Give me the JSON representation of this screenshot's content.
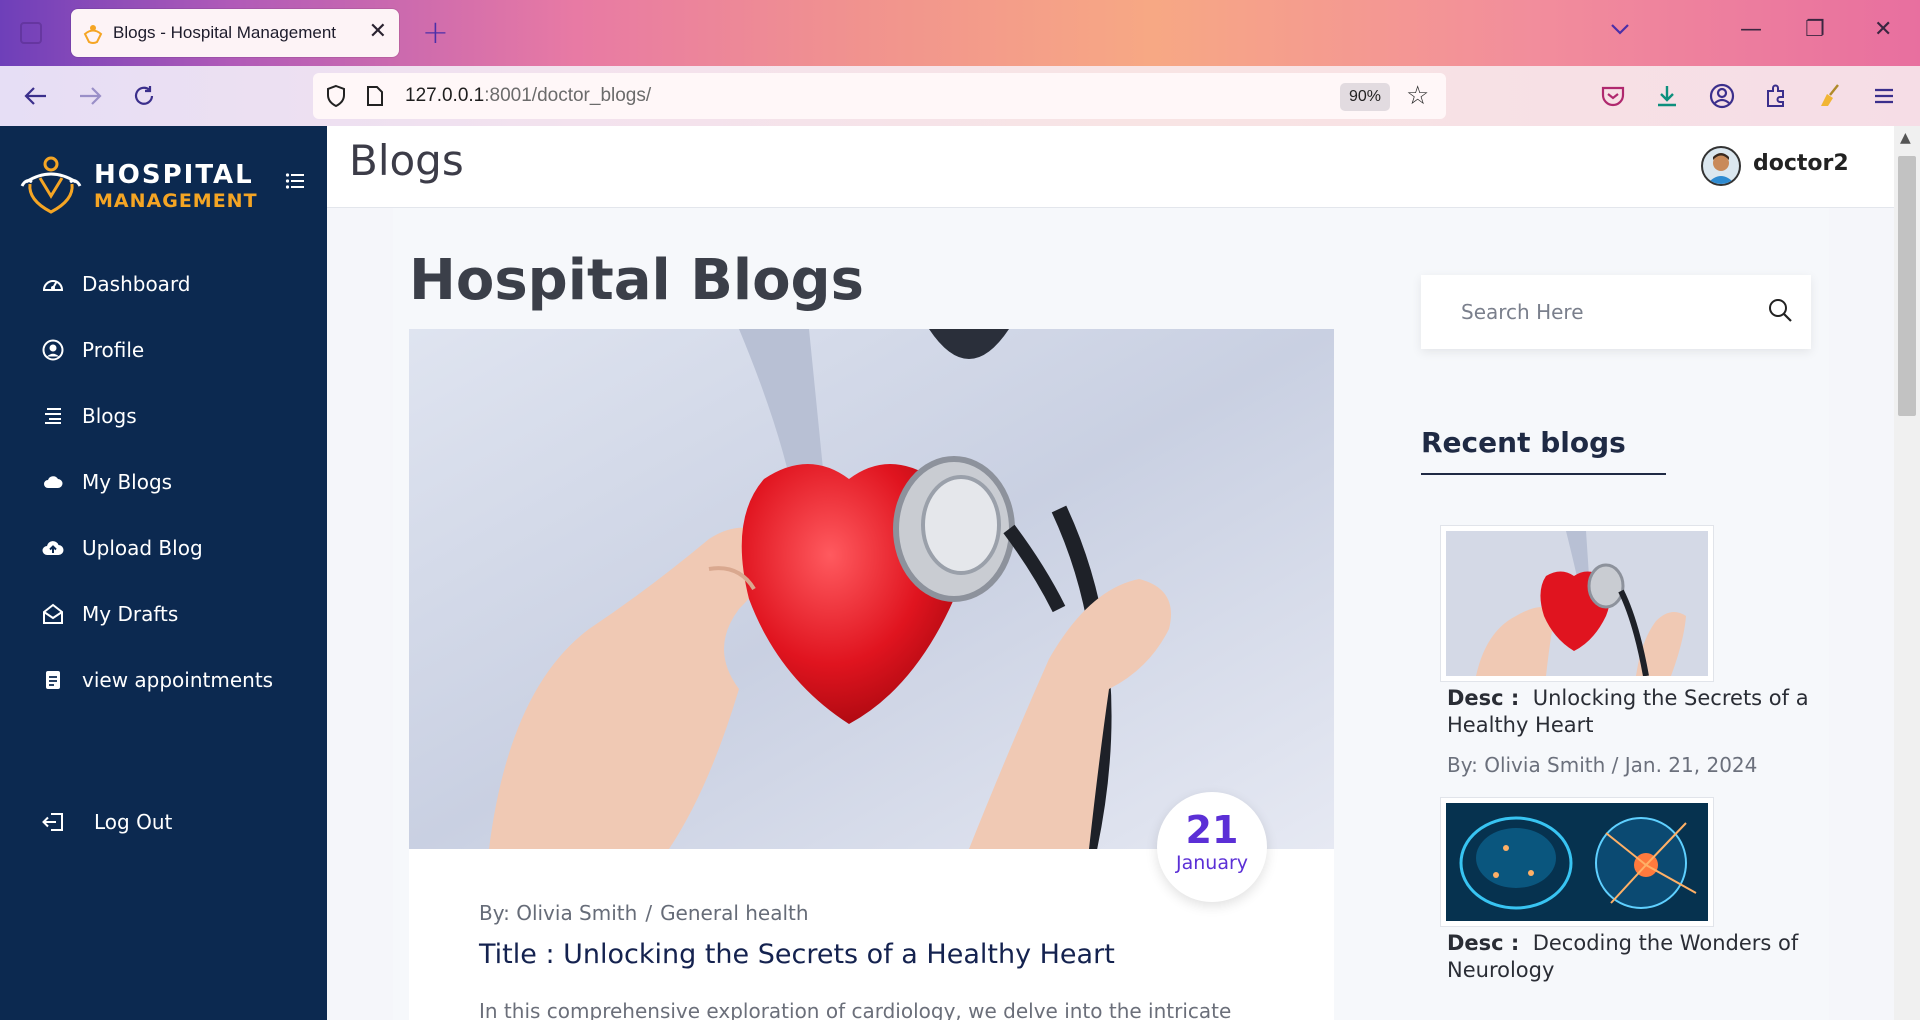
{
  "browser": {
    "tab_title": "Blogs - Hospital Management",
    "url_host": "127.0.0.1",
    "url_rest": ":8001/doctor_blogs/",
    "zoom": "90%"
  },
  "sidebar": {
    "brand_line1": "HOSPITAL",
    "brand_line2": "MANAGEMENT",
    "items": [
      {
        "label": "Dashboard",
        "icon": "dashboard-icon"
      },
      {
        "label": "Profile",
        "icon": "user-circle-icon"
      },
      {
        "label": "Blogs",
        "icon": "list-icon"
      },
      {
        "label": "My Blogs",
        "icon": "cloud-icon"
      },
      {
        "label": "Upload Blog",
        "icon": "cloud-upload-icon"
      },
      {
        "label": "My Drafts",
        "icon": "envelope-open-icon"
      },
      {
        "label": "view appointments",
        "icon": "document-icon"
      }
    ],
    "logout": {
      "label": "Log Out",
      "icon": "logout-icon"
    }
  },
  "header": {
    "title": "Blogs",
    "username": "doctor2"
  },
  "main": {
    "heading": "Hospital Blogs",
    "featured": {
      "day": "21",
      "month": "January",
      "author": "By: Olivia Smith",
      "meta_sep": "/",
      "category": "General health",
      "title": "Title :  Unlocking the Secrets of a Healthy Heart",
      "excerpt": "In this comprehensive exploration of cardiology, we delve into the intricate"
    }
  },
  "aside": {
    "search_placeholder": "Search Here",
    "recent_heading": "Recent blogs",
    "recent": [
      {
        "desc_label": "Desc :",
        "desc": "Unlocking the Secrets of a Healthy Heart",
        "meta": "By: Olivia Smith / Jan. 21, 2024"
      },
      {
        "desc_label": "Desc :",
        "desc": "Decoding the Wonders of Neurology",
        "meta": ""
      }
    ]
  },
  "colors": {
    "sidebar_bg": "#0c2950",
    "brand_accent": "#f5a524",
    "date_accent": "#5b2fd6"
  }
}
